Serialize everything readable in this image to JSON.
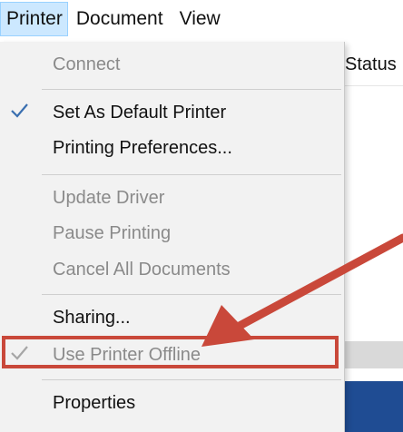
{
  "menubar": {
    "items": [
      {
        "label": "Printer"
      },
      {
        "label": "Document"
      },
      {
        "label": "View"
      }
    ]
  },
  "background": {
    "column_header": "Status"
  },
  "printer_menu": {
    "items": [
      {
        "label": "Connect",
        "enabled": false,
        "checked": false
      },
      {
        "label": "Set As Default Printer",
        "enabled": true,
        "checked": true
      },
      {
        "label": "Printing Preferences...",
        "enabled": true,
        "checked": false
      },
      {
        "label": "Update Driver",
        "enabled": false,
        "checked": false
      },
      {
        "label": "Pause Printing",
        "enabled": false,
        "checked": false
      },
      {
        "label": "Cancel All Documents",
        "enabled": false,
        "checked": false
      },
      {
        "label": "Sharing...",
        "enabled": true,
        "checked": false
      },
      {
        "label": "Use Printer Offline",
        "enabled": false,
        "checked": true
      },
      {
        "label": "Properties",
        "enabled": true,
        "checked": false
      }
    ]
  },
  "colors": {
    "menubar_active_bg": "#cce8ff",
    "check_enabled": "#3a6fb0",
    "check_disabled": "#a6a6a6",
    "annotation_red": "#c9483a",
    "menu_bg": "#f2f2f2"
  },
  "icons": {
    "check": "checkmark-icon",
    "annotation_arrow": "arrow-annotation"
  }
}
